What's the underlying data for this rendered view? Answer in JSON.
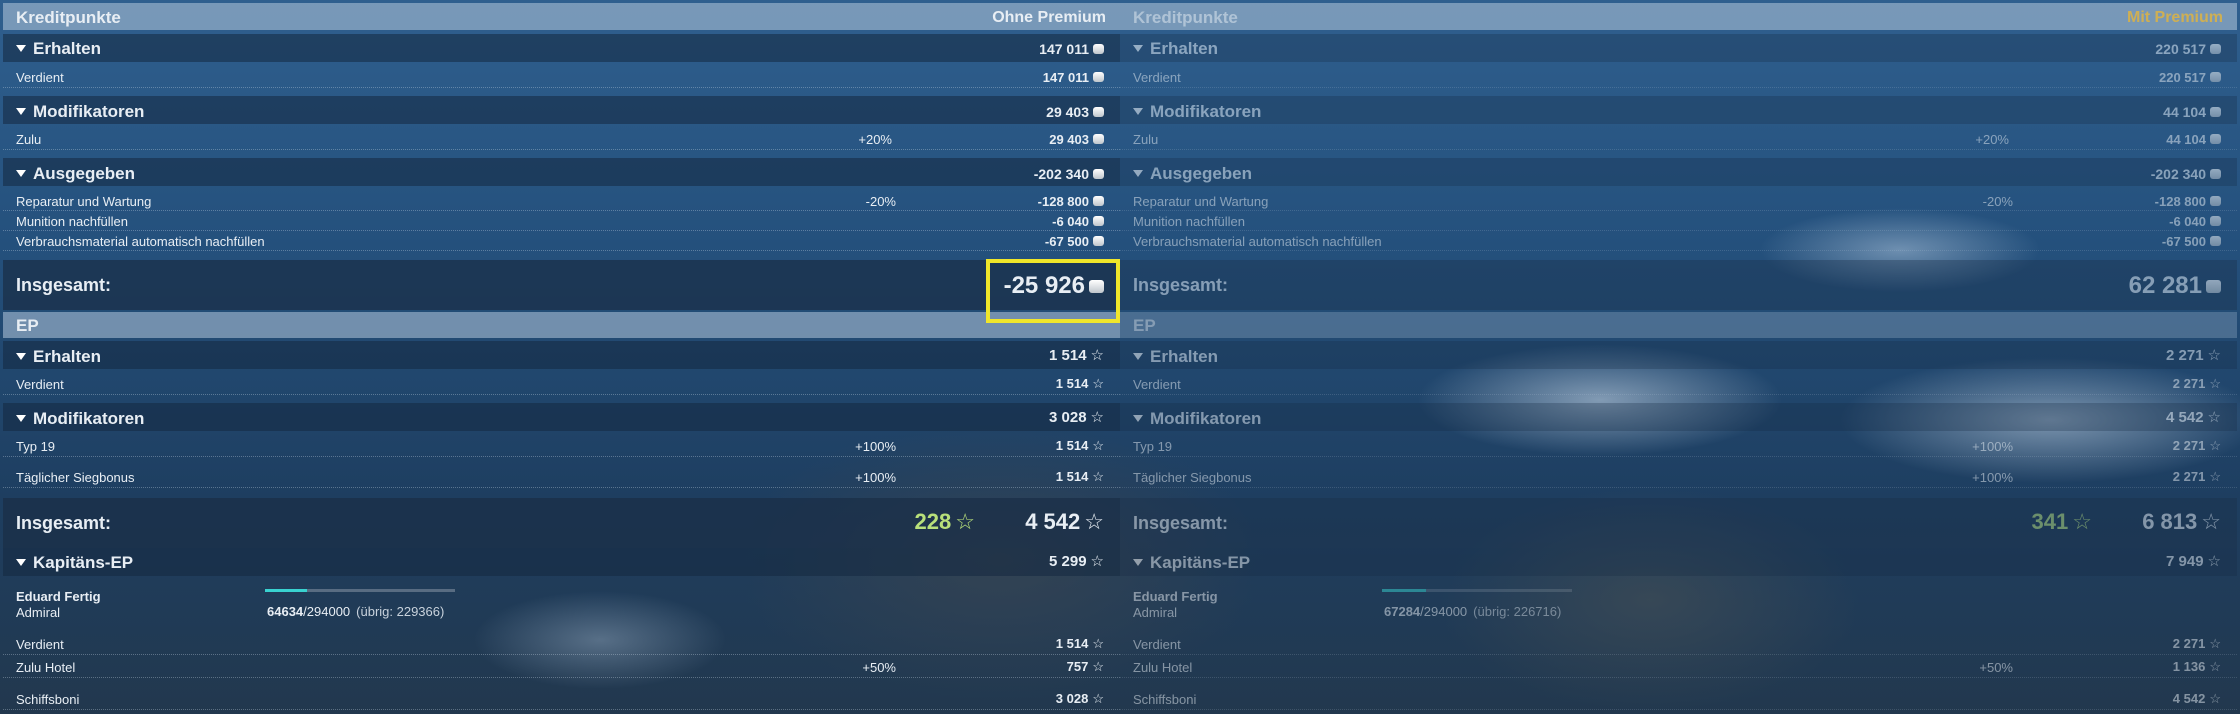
{
  "left": {
    "header": {
      "title": "Kreditpunkte",
      "mode": "Ohne Premium"
    },
    "erhalten": {
      "label": "Erhalten",
      "total": "147 011",
      "verdient_label": "Verdient",
      "verdient": "147 011"
    },
    "modifikatoren": {
      "label": "Modifikatoren",
      "total": "29 403",
      "zulu_label": "Zulu",
      "zulu_pct": "+20%",
      "zulu": "29 403"
    },
    "ausgegeben": {
      "label": "Ausgegeben",
      "total": "-202 340",
      "rep_label": "Reparatur und Wartung",
      "rep_pct": "-20%",
      "rep": "-128 800",
      "mun_label": "Munition nachfüllen",
      "mun": "-6 040",
      "ver_label": "Verbrauchsmaterial automatisch nachfüllen",
      "ver": "-67 500"
    },
    "credits_total": {
      "label": "Insgesamt:",
      "value": "-25 926"
    },
    "ep_header": "EP",
    "ep_erhalten": {
      "label": "Erhalten",
      "total": "1 514",
      "verdient_label": "Verdient",
      "verdient": "1 514"
    },
    "ep_mod": {
      "label": "Modifikatoren",
      "total": "3 028",
      "typ_label": "Typ 19",
      "typ_pct": "+100%",
      "typ": "1 514",
      "sieg_label": "Täglicher Siegbonus",
      "sieg_pct": "+100%",
      "sieg": "1 514"
    },
    "ep_total": {
      "label": "Insgesamt:",
      "free": "228",
      "value": "4 542"
    },
    "kapitan": {
      "label": "Kapitäns-EP",
      "total": "5 299",
      "name": "Eduard Fertig",
      "rank": "Admiral",
      "xp": "64634",
      "xp_max": "/294000",
      "remaining": "(übrig: 229366)",
      "progress": 0.22,
      "verdient_label": "Verdient",
      "verdient": "1 514",
      "hotel_label": "Zulu Hotel",
      "hotel_pct": "+50%",
      "hotel": "757",
      "schiff_label": "Schiffsboni",
      "schiff": "3 028"
    }
  },
  "right": {
    "header": {
      "title": "Kreditpunkte",
      "mode": "Mit Premium"
    },
    "erhalten": {
      "label": "Erhalten",
      "total": "220 517",
      "verdient_label": "Verdient",
      "verdient": "220 517"
    },
    "modifikatoren": {
      "label": "Modifikatoren",
      "total": "44 104",
      "zulu_label": "Zulu",
      "zulu_pct": "+20%",
      "zulu": "44 104"
    },
    "ausgegeben": {
      "label": "Ausgegeben",
      "total": "-202 340",
      "rep_label": "Reparatur und Wartung",
      "rep_pct": "-20%",
      "rep": "-128 800",
      "mun_label": "Munition nachfüllen",
      "mun": "-6 040",
      "ver_label": "Verbrauchsmaterial automatisch nachfüllen",
      "ver": "-67 500"
    },
    "credits_total": {
      "label": "Insgesamt:",
      "value": "62 281"
    },
    "ep_header": "EP",
    "ep_erhalten": {
      "label": "Erhalten",
      "total": "2 271",
      "verdient_label": "Verdient",
      "verdient": "2 271"
    },
    "ep_mod": {
      "label": "Modifikatoren",
      "total": "4 542",
      "typ_label": "Typ 19",
      "typ_pct": "+100%",
      "typ": "2 271",
      "sieg_label": "Täglicher Siegbonus",
      "sieg_pct": "+100%",
      "sieg": "2 271"
    },
    "ep_total": {
      "label": "Insgesamt:",
      "free": "341",
      "value": "6 813"
    },
    "kapitan": {
      "label": "Kapitäns-EP",
      "total": "7 949",
      "name": "Eduard Fertig",
      "rank": "Admiral",
      "xp": "67284",
      "xp_max": "/294000",
      "remaining": "(übrig: 226716)",
      "progress": 0.23,
      "verdient_label": "Verdient",
      "verdient": "2 271",
      "hotel_label": "Zulu Hotel",
      "hotel_pct": "+50%",
      "hotel": "1 136",
      "schiff_label": "Schiffsboni",
      "schiff": "4 542"
    }
  },
  "colors": {
    "highlight": "#f0e62a",
    "free_xp": "#b8e07a",
    "premium": "#d8b24a",
    "progress": "#39d2d0"
  }
}
